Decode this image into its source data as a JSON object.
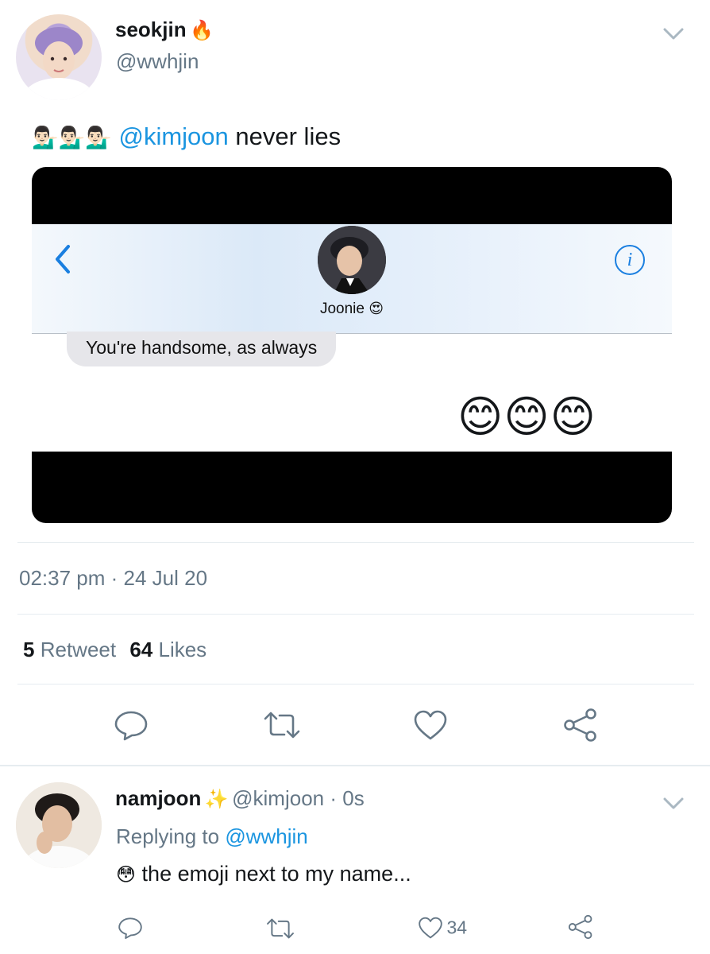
{
  "tweet": {
    "display_name": "seokjin",
    "name_emoji": "🔥",
    "handle": "@wwhjin",
    "text_emojis": "💁🏻‍♂️💁🏻‍♂️💁🏻‍♂️",
    "mention": "@kimjoon",
    "text_rest": " never lies",
    "time": "02:37 pm · 24 Jul 20",
    "retweets_count": "5",
    "retweets_label": "Retweet",
    "likes_count": "64",
    "likes_label": "Likes"
  },
  "screenshot": {
    "contact_name": "Joonie",
    "contact_emoji": "😍",
    "message": "You're handsome, as always",
    "reply_emojis": "😊😊😊",
    "info_glyph": "i"
  },
  "reply": {
    "display_name": "namjoon",
    "name_emoji": "✨",
    "handle_time": "@kimjoon · 0s",
    "replying_prefix": "Replying to",
    "replying_handle": "@wwhjin",
    "emoji": "😳",
    "text": "the emoji next to my name...",
    "likes_count": "34"
  },
  "icons": [
    "chevron-down-icon",
    "back-chevron-icon",
    "info-icon",
    "reply-icon",
    "retweet-icon",
    "like-icon",
    "share-icon"
  ],
  "colors": {
    "link": "#1b95e0",
    "muted": "#657786",
    "divider": "#e6ecf0",
    "ios_blue": "#1a7fe0"
  }
}
